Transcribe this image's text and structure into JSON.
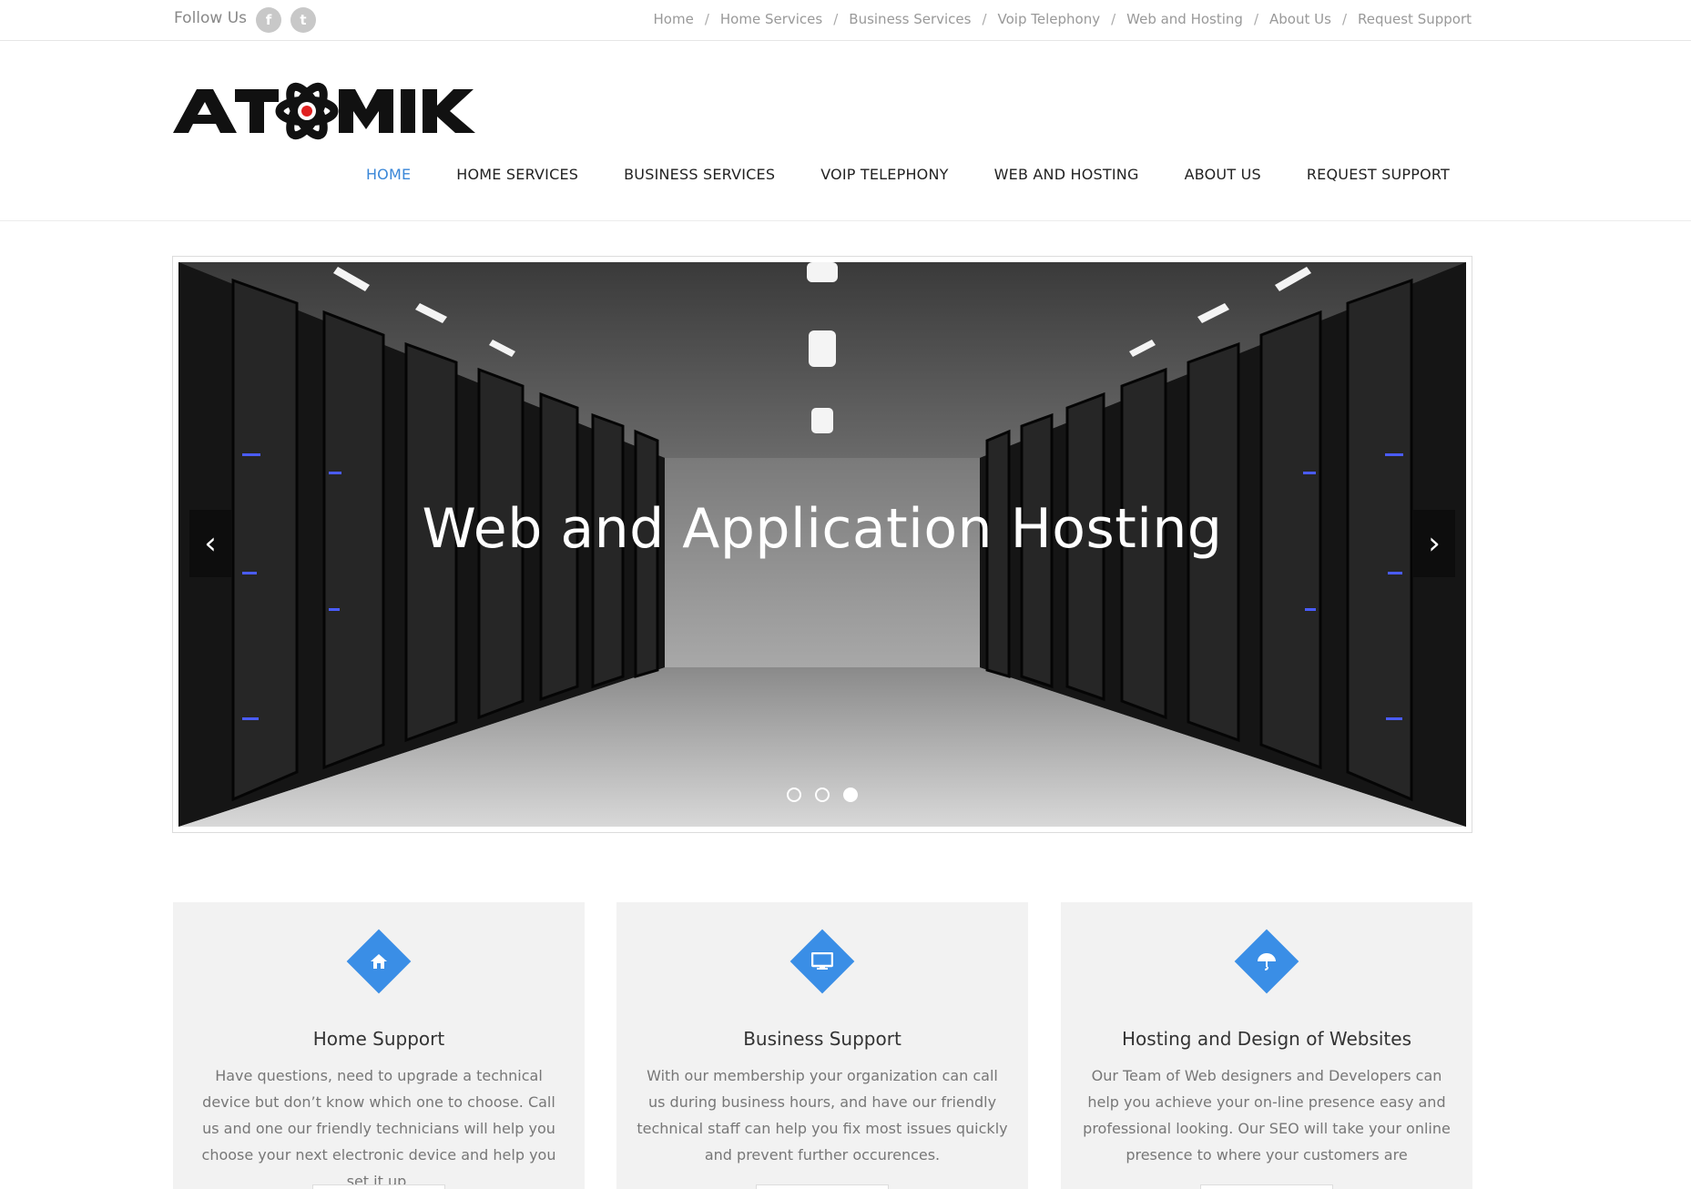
{
  "topbar": {
    "follow_label": "Follow Us",
    "social": [
      {
        "icon": "facebook-icon",
        "glyph": "f"
      },
      {
        "icon": "twitter-icon",
        "glyph": "t"
      }
    ],
    "breadcrumb": [
      "Home",
      "Home Services",
      "Business Services",
      "Voip Telephony",
      "Web and Hosting",
      "About Us",
      "Request Support"
    ]
  },
  "header": {
    "logo_text": "ATOMIK",
    "nav": [
      {
        "label": "HOME",
        "active": true
      },
      {
        "label": "HOME SERVICES",
        "active": false
      },
      {
        "label": "BUSINESS SERVICES",
        "active": false
      },
      {
        "label": "VOIP TELEPHONY",
        "active": false
      },
      {
        "label": "WEB AND HOSTING",
        "active": false
      },
      {
        "label": "ABOUT US",
        "active": false
      },
      {
        "label": "REQUEST SUPPORT",
        "active": false
      }
    ]
  },
  "slider": {
    "caption": "Web and Application Hosting",
    "prev_icon": "chevron-left-icon",
    "next_icon": "chevron-right-icon",
    "slide_count": 3,
    "active_slide": 3
  },
  "features": [
    {
      "icon": "home-icon",
      "title": "Home Support",
      "text": "Have questions, need to upgrade a technical device but don’t know which one to choose. Call us and one our friendly technicians will help you choose your next electronic device and help you set it up."
    },
    {
      "icon": "monitor-icon",
      "title": "Business Support",
      "text": "With our membership your organization can call us during business hours, and have our friendly technical staff can help you fix most issues quickly and prevent further occurences."
    },
    {
      "icon": "umbrella-icon",
      "title": "Hosting and Design of Websites",
      "text": "Our Team of Web designers and Developers can help you achieve your on-line presence easy and professional looking. Our SEO will take your online presence to where your customers are"
    }
  ],
  "colors": {
    "accent": "#3a8ee6",
    "nav_active": "#3a87d8",
    "logo_red": "#e02020"
  }
}
